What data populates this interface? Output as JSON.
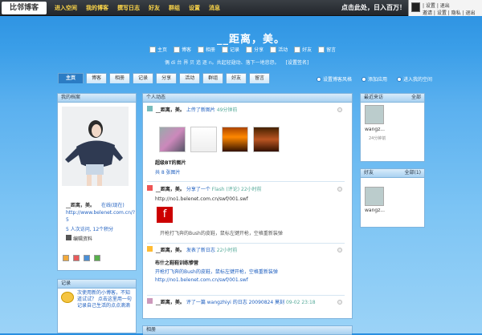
{
  "topbar": {
    "logo": "比邻博客",
    "nav": [
      "进入空间",
      "我的博客",
      "撰写日志",
      "好友",
      "群组",
      "设置",
      "消息"
    ],
    "promo": "点击此处，日入百万！",
    "user": {
      "line1": "| 设置 | 退出",
      "line2": "邀请 | 设置 | 隐私 | 退出"
    }
  },
  "header": {
    "title": "__距离，美。",
    "quicknav": [
      "主页",
      "博客",
      "相册",
      "记录",
      "分享",
      "活动",
      "好友",
      "留言"
    ],
    "signature": "偶 di 台 界 贝 追 逐 n。共起轻翅动、落下一地悲怨。",
    "set_signature": "[设置签名]"
  },
  "tabs": [
    "主页",
    "博客",
    "相册",
    "记录",
    "分享",
    "活动",
    "群组",
    "好友",
    "留言"
  ],
  "options": [
    "设置博客风格",
    "添加应用",
    "进入我的空间"
  ],
  "profile": {
    "title": "我的档案",
    "name": "__距离，美。",
    "status": "在线(现在)",
    "link": "http://www.belenet.com.cn/?5",
    "stats": "5 人次访问, 12个积分",
    "edit": "编辑资料"
  },
  "records": {
    "title": "记录",
    "text": "次使用新的小博客，不知道试试？ 点击这里用一句记录自己生活的点点滴滴"
  },
  "feed": {
    "title": "个人动态",
    "items": [
      {
        "user": "__距离，美。",
        "action": "上传了新图片",
        "time": "49分钟前",
        "title": "超级BT的图片",
        "count": "共 8 张图片"
      },
      {
        "user": "__距离，美。",
        "action": "分享了一个",
        "target": "Flash (评论)",
        "time": "22小时前",
        "url": "http://no1.belenet.com.cn/swf/001.swf",
        "quote": "开枪打飞奔的Bush的皮鞋，鼠标左键开枪，空格重新装弹"
      },
      {
        "user": "__距离，美。",
        "action": "发表了新日志",
        "time": "22小时前",
        "title": "布什之鞋鞋训练惨营",
        "body": "开枪打飞奔的Bush的皮鞋，鼠标左键开枪，空格重新装弹 http://no1.belenet.com.cn/swf/001.swf"
      },
      {
        "user": "__距离，美。",
        "action": "评了一篇 wangzhiyi 的日志 20090824 莫刻",
        "time": "09-02 23:18"
      }
    ],
    "next_title": "相册"
  },
  "visitors": {
    "title": "最近来访",
    "all": "全部",
    "name": "wangz...",
    "time": "24分钟前"
  },
  "friends": {
    "title": "好友",
    "all": "全部(1)",
    "name": "wangz..."
  }
}
